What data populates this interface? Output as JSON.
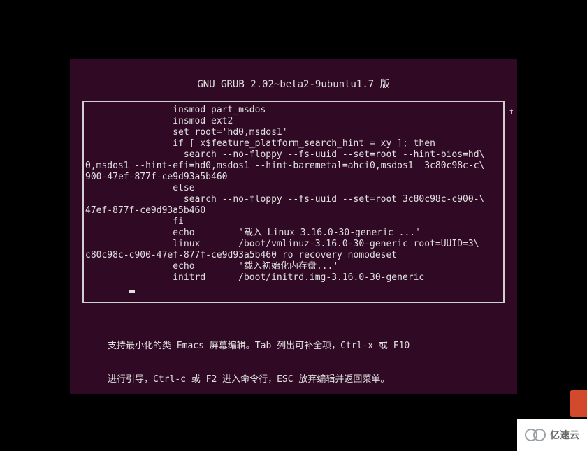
{
  "title": "GNU GRUB  2.02~beta2-9ubuntu1.7 版",
  "scroll_indicator": "↑",
  "editor_lines": [
    "                insmod part_msdos",
    "                insmod ext2",
    "                set root='hd0,msdos1'",
    "                if [ x$feature_platform_search_hint = xy ]; then",
    "                  search --no-floppy --fs-uuid --set=root --hint-bios=hd\\",
    "0,msdos1 --hint-efi=hd0,msdos1 --hint-baremetal=ahci0,msdos1  3c80c98c-c\\",
    "900-47ef-877f-ce9d93a5b460",
    "                else",
    "                  search --no-floppy --fs-uuid --set=root 3c80c98c-c900-\\",
    "47ef-877f-ce9d93a5b460",
    "                fi",
    "                echo        '载入 Linux 3.16.0-30-generic ...'",
    "                linux       /boot/vmlinuz-3.16.0-30-generic root=UUID=3\\",
    "c80c98c-c900-47ef-877f-ce9d93a5b460 ro recovery nomodeset",
    "                echo        '载入初始化内存盘...'",
    "                initrd      /boot/initrd.img-3.16.0-30-generic"
  ],
  "help": {
    "line1": "支持最小化的类 Emacs 屏幕编辑。Tab 列出可补全项，Ctrl-x 或 F10",
    "line2": "进行引导，Ctrl-c 或 F2 进入命令行，ESC 放弃编辑并返回菜单。"
  },
  "footer_brand": "亿速云"
}
